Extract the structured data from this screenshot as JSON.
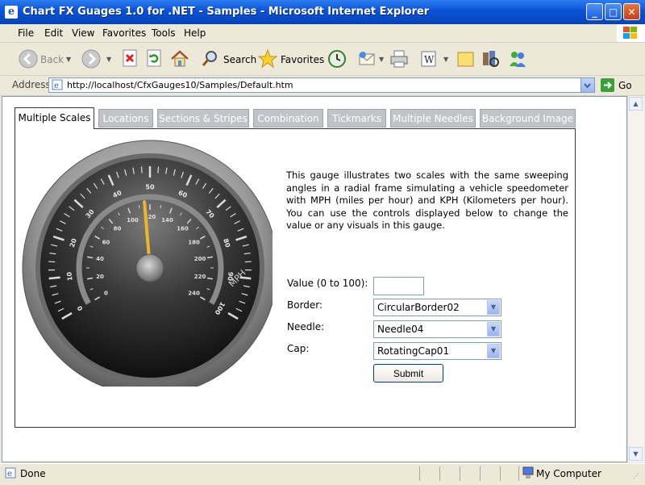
{
  "window": {
    "title": "Chart FX Guages 1.0 for .NET - Samples - Microsoft Internet Explorer",
    "min_glyph": "_",
    "max_glyph": "□",
    "close_glyph": "✕"
  },
  "menu": {
    "items": [
      {
        "label": "File"
      },
      {
        "label": "Edit"
      },
      {
        "label": "View"
      },
      {
        "label": "Favorites"
      },
      {
        "label": "Tools"
      },
      {
        "label": "Help"
      }
    ]
  },
  "toolbar": {
    "back_label": "Back",
    "search_label": "Search",
    "favorites_label": "Favorites"
  },
  "address": {
    "label": "Address",
    "url": "http://localhost/CfxGauges10/Samples/Default.htm",
    "go_label": "Go"
  },
  "tabs": [
    {
      "label": "Multiple Scales",
      "active": true
    },
    {
      "label": "Locations",
      "active": false
    },
    {
      "label": "Sections & Stripes",
      "active": false
    },
    {
      "label": "Combination",
      "active": false
    },
    {
      "label": "Tickmarks",
      "active": false
    },
    {
      "label": "Multiple Needles",
      "active": false
    },
    {
      "label": "Background Image",
      "active": false
    }
  ],
  "description": "This gauge illustrates two scales with the same sweeping angles in a radial frame simulating a vehicle speedometer with MPH (miles per hour) and KPH (Kilometers per hour). You can use the controls displayed below to change the value or any visuals in this gauge.",
  "form": {
    "value_label": "Value (0 to 100):",
    "value": "",
    "border_label": "Border:",
    "border_value": "CircularBorder02",
    "needle_label": "Needle:",
    "needle_value": "Needle04",
    "cap_label": "Cap:",
    "cap_value": "RotatingCap01",
    "submit_label": "Submit"
  },
  "gauge": {
    "outer_ticks": [
      "0",
      "10",
      "20",
      "30",
      "40",
      "50",
      "60",
      "70",
      "80",
      "90",
      "100"
    ],
    "inner_ticks": [
      "0",
      "20",
      "40",
      "60",
      "80",
      "100",
      "120",
      "140",
      "160",
      "180",
      "200",
      "220",
      "240"
    ],
    "unit_label": "MPH",
    "needle_value": 48,
    "needle_color": "#e8b82a"
  },
  "status": {
    "text": "Done",
    "zone": "My Computer"
  },
  "colors": {
    "title_bar": "#0a52d6",
    "inactive_tab": "#c0c4c8"
  }
}
